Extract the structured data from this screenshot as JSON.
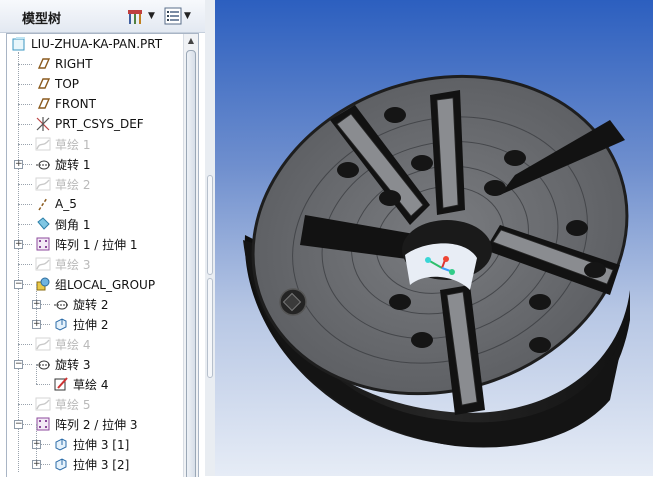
{
  "panel": {
    "title": "模型树",
    "settings_button": "tree-settings",
    "show_button": "tree-show"
  },
  "tree": {
    "root_label": "LIU-ZHUA-KA-PAN.PRT",
    "items": [
      {
        "label": "RIGHT",
        "icon": "datum-plane-icon",
        "muted": false,
        "expander": false,
        "level": 1
      },
      {
        "label": "TOP",
        "icon": "datum-plane-icon",
        "muted": false,
        "expander": false,
        "level": 1
      },
      {
        "label": "FRONT",
        "icon": "datum-plane-icon",
        "muted": false,
        "expander": false,
        "level": 1
      },
      {
        "label": "PRT_CSYS_DEF",
        "icon": "coordinate-system-icon",
        "muted": false,
        "expander": false,
        "level": 1
      },
      {
        "label": "草绘 1",
        "icon": "sketch-icon",
        "muted": true,
        "expander": false,
        "level": 1
      },
      {
        "label": "旋转 1",
        "icon": "revolve-icon",
        "muted": false,
        "expander": true,
        "level": 1
      },
      {
        "label": "草绘 2",
        "icon": "sketch-icon",
        "muted": true,
        "expander": false,
        "level": 1
      },
      {
        "label": "A_5",
        "icon": "datum-axis-icon",
        "muted": false,
        "expander": false,
        "level": 1
      },
      {
        "label": "倒角 1",
        "icon": "chamfer-icon",
        "muted": false,
        "expander": false,
        "level": 1
      },
      {
        "label": "阵列 1 / 拉伸 1",
        "icon": "pattern-icon",
        "muted": false,
        "expander": true,
        "level": 1
      },
      {
        "label": "草绘 3",
        "icon": "sketch-icon",
        "muted": true,
        "expander": false,
        "level": 1
      },
      {
        "label": "组LOCAL_GROUP",
        "icon": "group-icon",
        "muted": false,
        "expander": true,
        "expanded": true,
        "level": 1
      },
      {
        "label": "旋转 2",
        "icon": "revolve-icon",
        "muted": false,
        "expander": true,
        "level": 2
      },
      {
        "label": "拉伸 2",
        "icon": "extrude-icon",
        "muted": false,
        "expander": true,
        "level": 2
      },
      {
        "label": "草绘 4",
        "icon": "sketch-icon",
        "muted": true,
        "expander": false,
        "level": 1
      },
      {
        "label": "旋转 3",
        "icon": "revolve-icon",
        "muted": false,
        "expander": true,
        "expanded": true,
        "level": 1
      },
      {
        "label": "草绘 4",
        "icon": "sketch-edit-icon",
        "muted": false,
        "expander": false,
        "level": 2
      },
      {
        "label": "草绘 5",
        "icon": "sketch-icon",
        "muted": true,
        "expander": false,
        "level": 1
      },
      {
        "label": "阵列 2 / 拉伸 3",
        "icon": "pattern-icon",
        "muted": false,
        "expander": true,
        "expanded": true,
        "level": 1
      },
      {
        "label": "拉伸 3 [1]",
        "icon": "extrude-icon",
        "muted": false,
        "expander": true,
        "level": 2
      },
      {
        "label": "拉伸 3 [2]",
        "icon": "extrude-icon",
        "muted": false,
        "expander": true,
        "level": 2
      }
    ]
  },
  "colors": {
    "viewport_top": "#2c5fbf",
    "viewport_bottom": "#e6ecf6",
    "part_dark": "#1c1c1c",
    "part_face": "#6d6f73",
    "muted_text": "#b9b9b9"
  }
}
